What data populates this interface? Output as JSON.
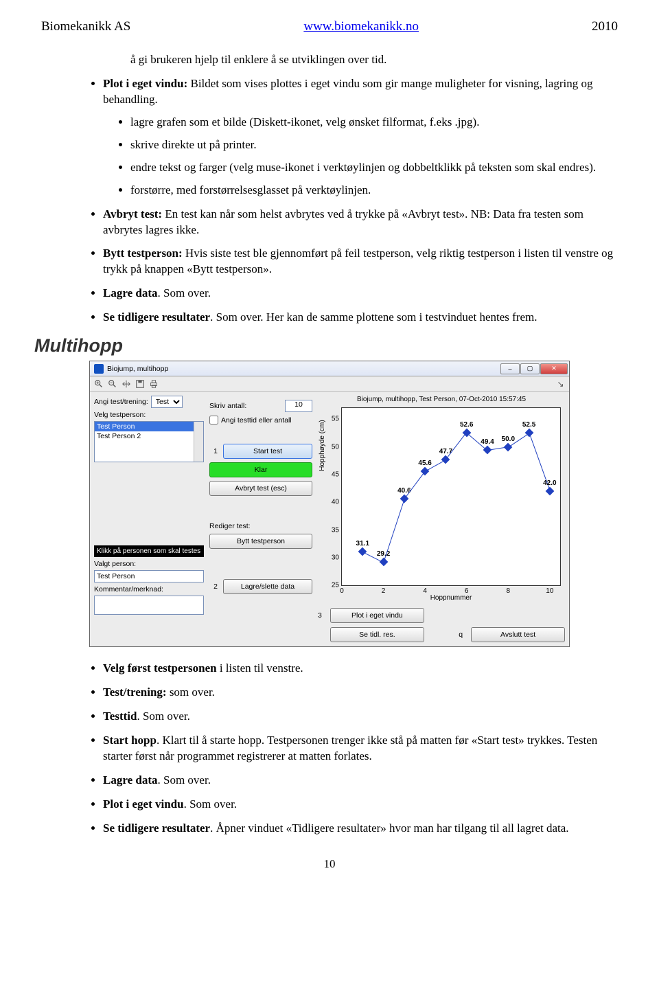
{
  "header": {
    "company": "Biomekanikk AS",
    "url": "www.biomekanikk.no",
    "year": "2010"
  },
  "doc": {
    "intro_bullets": {
      "p0": "å gi brukeren hjelp til enklere å se utviklingen over tid.",
      "p1a": "Plot i eget vindu:",
      "p1b": " Bildet som vises plottes i eget vindu som gir mange muligheter for visning, lagring og behandling.",
      "sub1": "lagre grafen som et bilde (Diskett-ikonet, velg ønsket filformat, f.eks .jpg).",
      "sub2": "skrive direkte ut på printer.",
      "sub3": "endre tekst og farger (velg muse-ikonet i verktøylinjen og dobbeltklikk på teksten som skal endres).",
      "sub4": "forstørre, med forstørrelsesglasset på verktøylinjen.",
      "p2a": "Avbryt test:",
      "p2b": " En test kan når som helst avbrytes ved å trykke på «Avbryt test». NB: Data fra testen som avbrytes lagres ikke.",
      "p3a": "Bytt testperson:",
      "p3b": " Hvis siste test ble gjennomført på feil testperson, velg riktig testperson i listen til venstre og trykk på knappen «Bytt testperson».",
      "p4a": "Lagre data",
      "p4b": ". Som over.",
      "p5a": "Se tidligere resultater",
      "p5b": ". Som over. Her kan de samme plottene som i testvinduet hentes frem."
    },
    "section_title": "Multihopp",
    "after_bullets": {
      "a1a": "Velg først testpersonen",
      "a1b": " i listen til venstre.",
      "a2a": "Test/trening:",
      "a2b": " som over.",
      "a3a": "Testtid",
      "a3b": ". Som over.",
      "a4a": "Start hopp",
      "a4b": ". Klart til å starte hopp. Testpersonen trenger ikke stå på matten før «Start test» trykkes. Testen starter først når programmet registrerer at matten forlates.",
      "a5a": "Lagre data",
      "a5b": ". Som over.",
      "a6a": "Plot i eget vindu",
      "a6b": ". Som over.",
      "a7a": "Se tidligere resultater",
      "a7b": ". Åpner vinduet «Tidligere resultater» hvor man har tilgang til all lagret data."
    },
    "page": "10"
  },
  "app": {
    "title": "Biojump, multihopp",
    "plot_title": "Biojump, multihopp, Test Person, 07-Oct-2010 15:57:45",
    "left": {
      "mode_label": "Angi test/trening:",
      "mode_value": "Test",
      "pick_label": "Velg testperson:",
      "persons": [
        "Test Person",
        "Test Person 2"
      ],
      "helptext": "Klikk på personen som skal testes",
      "chosen_label": "Valgt person:",
      "chosen_value": "Test Person",
      "comment_label": "Kommentar/merknad:"
    },
    "mid": {
      "count_label": "Skriv antall:",
      "count_value": "10",
      "check_label": "Angi testtid eller antall",
      "start": "Start test",
      "ready": "Klar",
      "abort": "Avbryt test (esc)",
      "edit_label": "Rediger test:",
      "swap": "Bytt testperson",
      "save": "Lagre/slette data",
      "tidl": "Se tidl. res.",
      "plot": "Plot i eget vindu",
      "quit": "Avslutt test",
      "n1": "1",
      "n2": "2",
      "n3": "3",
      "nq": "q"
    },
    "axes": {
      "ylabel": "Hopphøyde (cm)",
      "xlabel": "Hoppnummer"
    }
  },
  "chart_data": {
    "type": "line",
    "title": "Biojump, multihopp, Test Person, 07-Oct-2010 15:57:45",
    "xlabel": "Hoppnummer",
    "ylabel": "Hopphøyde (cm)",
    "x": [
      1,
      2,
      3,
      4,
      5,
      6,
      7,
      8,
      9,
      10
    ],
    "values": [
      31.1,
      29.2,
      40.6,
      45.6,
      47.7,
      52.6,
      49.4,
      50.0,
      52.5,
      42.0
    ],
    "xticks": [
      0,
      2,
      4,
      6,
      8,
      10
    ],
    "yticks": [
      25,
      30,
      35,
      40,
      45,
      50,
      55
    ],
    "xlim": [
      0,
      10.5
    ],
    "ylim": [
      25,
      57
    ]
  }
}
